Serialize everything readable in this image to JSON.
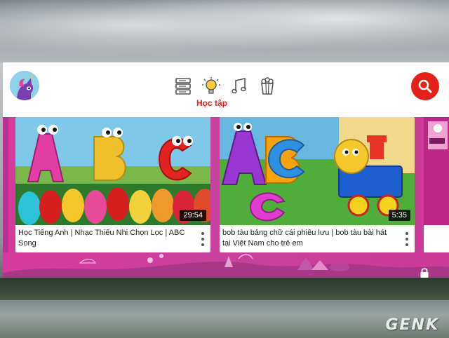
{
  "watermark": "GENK",
  "app": {
    "avatar_icon": "pony-avatar-icon",
    "categories": [
      {
        "name": "shows-icon",
        "selected": false
      },
      {
        "name": "learning-lightbulb-icon",
        "selected": true
      },
      {
        "name": "music-note-icon",
        "selected": false
      },
      {
        "name": "popcorn-explore-icon",
        "selected": false
      }
    ],
    "selected_category_label": "Học tập",
    "search_icon": "search-icon",
    "accent_color": "#e62117",
    "content_bg_color": "#d63a9c",
    "videos": [
      {
        "title": "Học Tiếng Anh | Nhạc Thiếu Nhi Chọn Lọc |  ABC Song",
        "duration": "29:54"
      },
      {
        "title": "bob tàu bảng chữ cái phiêu lưu | bob tàu bài hát tại Việt Nam cho trẻ em",
        "duration": "5:35"
      }
    ],
    "lock_icon": "lock-icon"
  }
}
